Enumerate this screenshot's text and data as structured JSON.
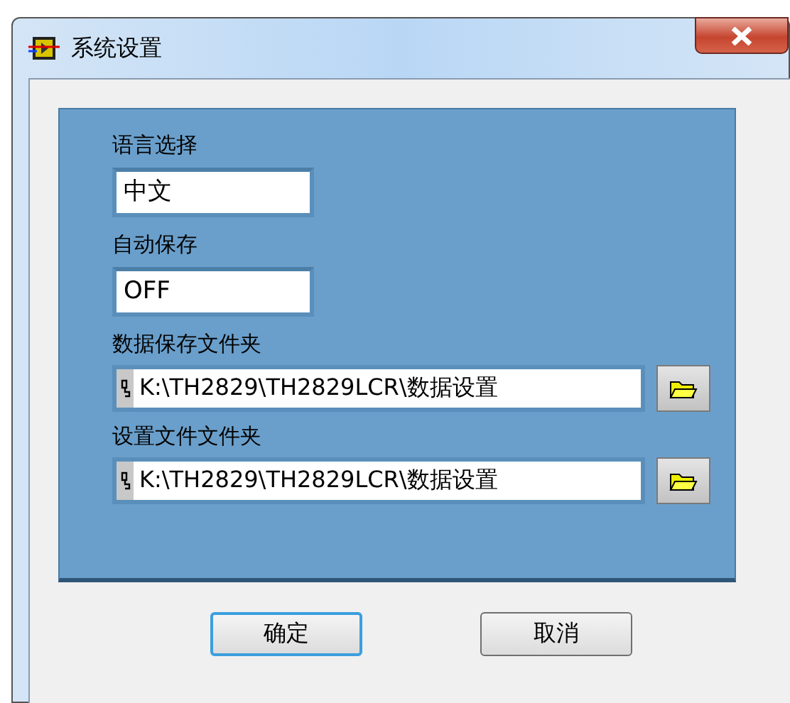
{
  "window": {
    "title": "系统设置"
  },
  "settings": [
    {
      "kind": "text",
      "label": "语言选择",
      "value": "中文"
    },
    {
      "kind": "text",
      "label": "自动保存",
      "value": "OFF"
    },
    {
      "kind": "path",
      "label": "数据保存文件夹",
      "value": "K:\\TH2829\\TH2829LCR\\数据设置"
    },
    {
      "kind": "path",
      "label": "设置文件文件夹",
      "value": "K:\\TH2829\\TH2829LCR\\数据设置"
    }
  ],
  "buttons": [
    {
      "label": "确定",
      "focused": true
    },
    {
      "label": "取消",
      "focused": false
    }
  ]
}
